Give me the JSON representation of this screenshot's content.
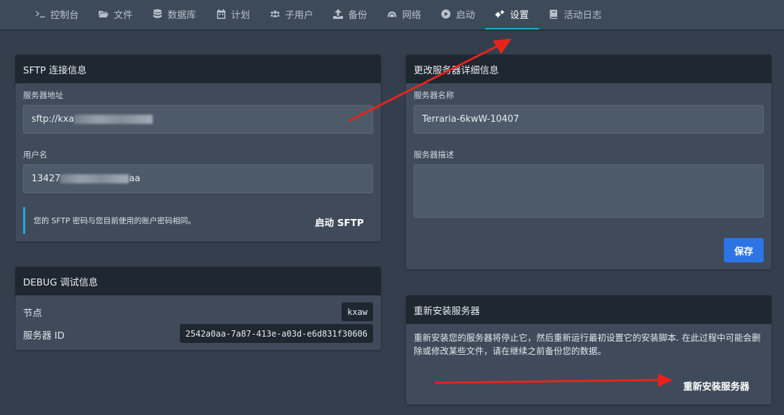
{
  "nav": {
    "items": [
      {
        "label": "控制台",
        "icon": "terminal-icon"
      },
      {
        "label": "文件",
        "icon": "folder-icon"
      },
      {
        "label": "数据库",
        "icon": "database-icon"
      },
      {
        "label": "计划",
        "icon": "calendar-icon"
      },
      {
        "label": "子用户",
        "icon": "users-icon"
      },
      {
        "label": "备份",
        "icon": "upload-icon"
      },
      {
        "label": "网络",
        "icon": "network-icon"
      },
      {
        "label": "启动",
        "icon": "play-icon"
      },
      {
        "label": "设置",
        "icon": "gears-icon"
      },
      {
        "label": "活动日志",
        "icon": "book-icon"
      }
    ],
    "active_index": 8,
    "active_color": "#2ba6d8"
  },
  "sftp": {
    "title": "SFTP 连接信息",
    "address_label": "服务器地址",
    "address_value": "sftp://kxa",
    "username_label": "用户名",
    "username_prefix": "13427",
    "username_suffix": "aa",
    "note": "您的 SFTP 密码与您目前使用的账户密码相同。",
    "launch_label": "启动 SFTP"
  },
  "debug": {
    "title": "DEBUG 调试信息",
    "node_label": "节点",
    "node_value": "kxaw",
    "server_id_label": "服务器 ID",
    "server_id_value": "2542a0aa-7a87-413e-a03d-e6d831f30606"
  },
  "details": {
    "title": "更改服务器详细信息",
    "name_label": "服务器名称",
    "name_value": "Terraria-6kwW-10407",
    "description_label": "服务器描述",
    "description_value": "",
    "save_label": "保存",
    "save_color": "#2c74e6"
  },
  "reinstall": {
    "title": "重新安装服务器",
    "description": "重新安装您的服务器将停止它，然后重新运行最初设置它的安装脚本. 在此过程中可能会删除或修改某些文件，请在继续之前备份您的数据。",
    "action_label": "重新安装服务器"
  },
  "annotation_color": "#e8231c"
}
